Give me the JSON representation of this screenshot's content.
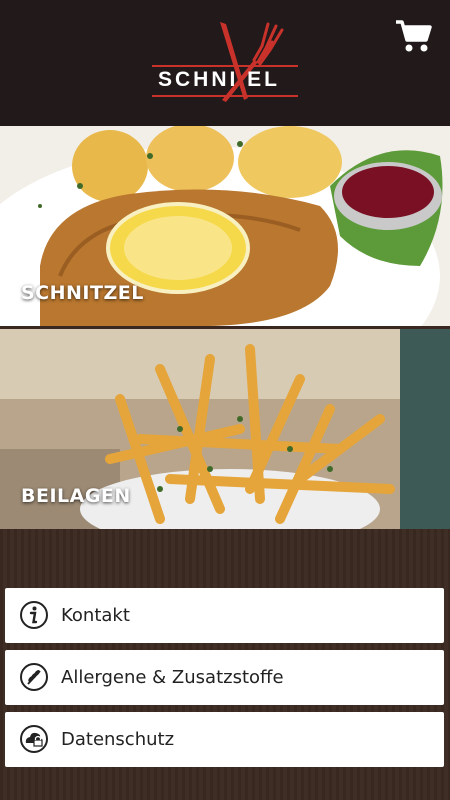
{
  "header": {
    "logo_text": "SCHNI  EL",
    "cart_icon": "shopping-cart-icon",
    "accent_color": "#c8322b"
  },
  "tiles": [
    {
      "label": "SCHNITZEL"
    },
    {
      "label": "BEILAGEN"
    }
  ],
  "menu": [
    {
      "label": "Kontakt",
      "icon": "info-icon"
    },
    {
      "label": "Allergene & Zusatzstoffe",
      "icon": "wheat-icon"
    },
    {
      "label": "Datenschutz",
      "icon": "cloud-lock-icon"
    }
  ]
}
